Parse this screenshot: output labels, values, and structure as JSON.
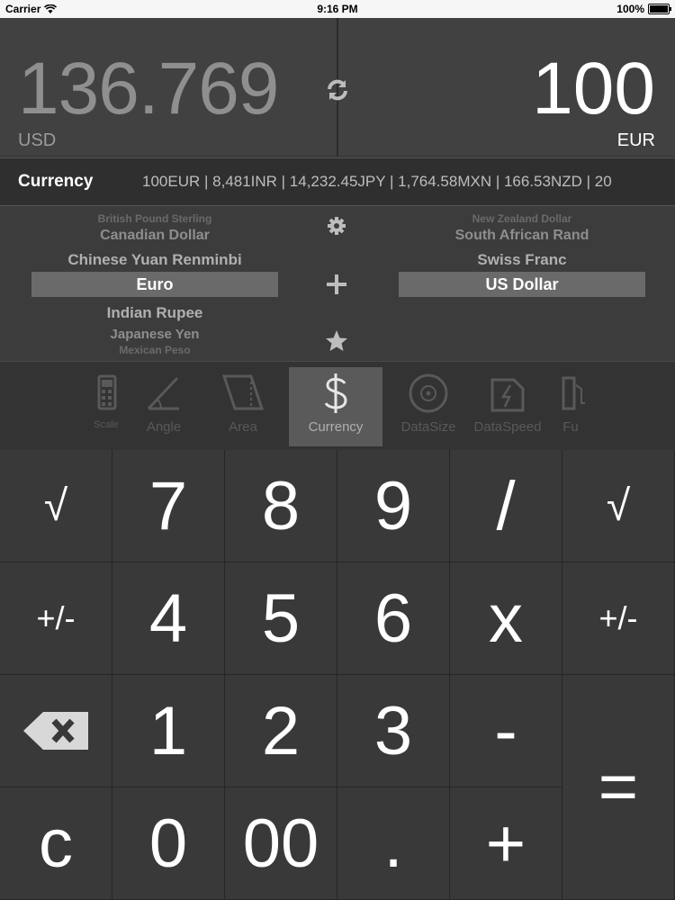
{
  "status_bar": {
    "carrier": "Carrier",
    "time": "9:16 PM",
    "battery": "100%",
    "battery_level": 1.0
  },
  "display": {
    "left_value": "136.769",
    "left_unit": "USD",
    "right_value": "100",
    "right_unit": "EUR"
  },
  "strip": {
    "label": "Currency",
    "rates": "100EUR  |  8,481INR  |  14,232.45JPY  |  1,764.58MXN  |  166.53NZD  |  20"
  },
  "picker_left": {
    "above2": "British Pound Sterling",
    "above1": "Canadian Dollar",
    "above0": "Chinese Yuan Renminbi",
    "selected": "Euro",
    "below0": "Indian Rupee",
    "below1": "Japanese Yen",
    "below2": "Mexican Peso"
  },
  "picker_right": {
    "above2": "New Zealand Dollar",
    "above1": "South African Rand",
    "above0": "Swiss Franc",
    "selected": "US Dollar"
  },
  "categories": [
    {
      "label": "Scale",
      "icon": "calculator-icon"
    },
    {
      "label": "Angle",
      "icon": "angle-icon"
    },
    {
      "label": "Area",
      "icon": "area-icon"
    },
    {
      "label": "Currency",
      "icon": "dollar-icon"
    },
    {
      "label": "DataSize",
      "icon": "disc-icon"
    },
    {
      "label": "DataSpeed",
      "icon": "dataspeed-icon"
    },
    {
      "label": "Fu",
      "icon": "fuel-icon"
    }
  ],
  "keys": {
    "sqrt_left": "√",
    "seven": "7",
    "eight": "8",
    "nine": "9",
    "divide": "/",
    "sqrt_right": "√",
    "plusminus_left": "+/-",
    "four": "4",
    "five": "5",
    "six": "6",
    "multiply": "x",
    "plusminus_right": "+/-",
    "one": "1",
    "two": "2",
    "three": "3",
    "minus": "-",
    "equals": "=",
    "clear": "c",
    "zero": "0",
    "double_zero": "00",
    "decimal": ".",
    "plus": "+"
  },
  "colors": {
    "background": "#3a3a3a",
    "key": "#393939",
    "selection": "#6a6a6a",
    "active_category": "#5a5a5a"
  }
}
